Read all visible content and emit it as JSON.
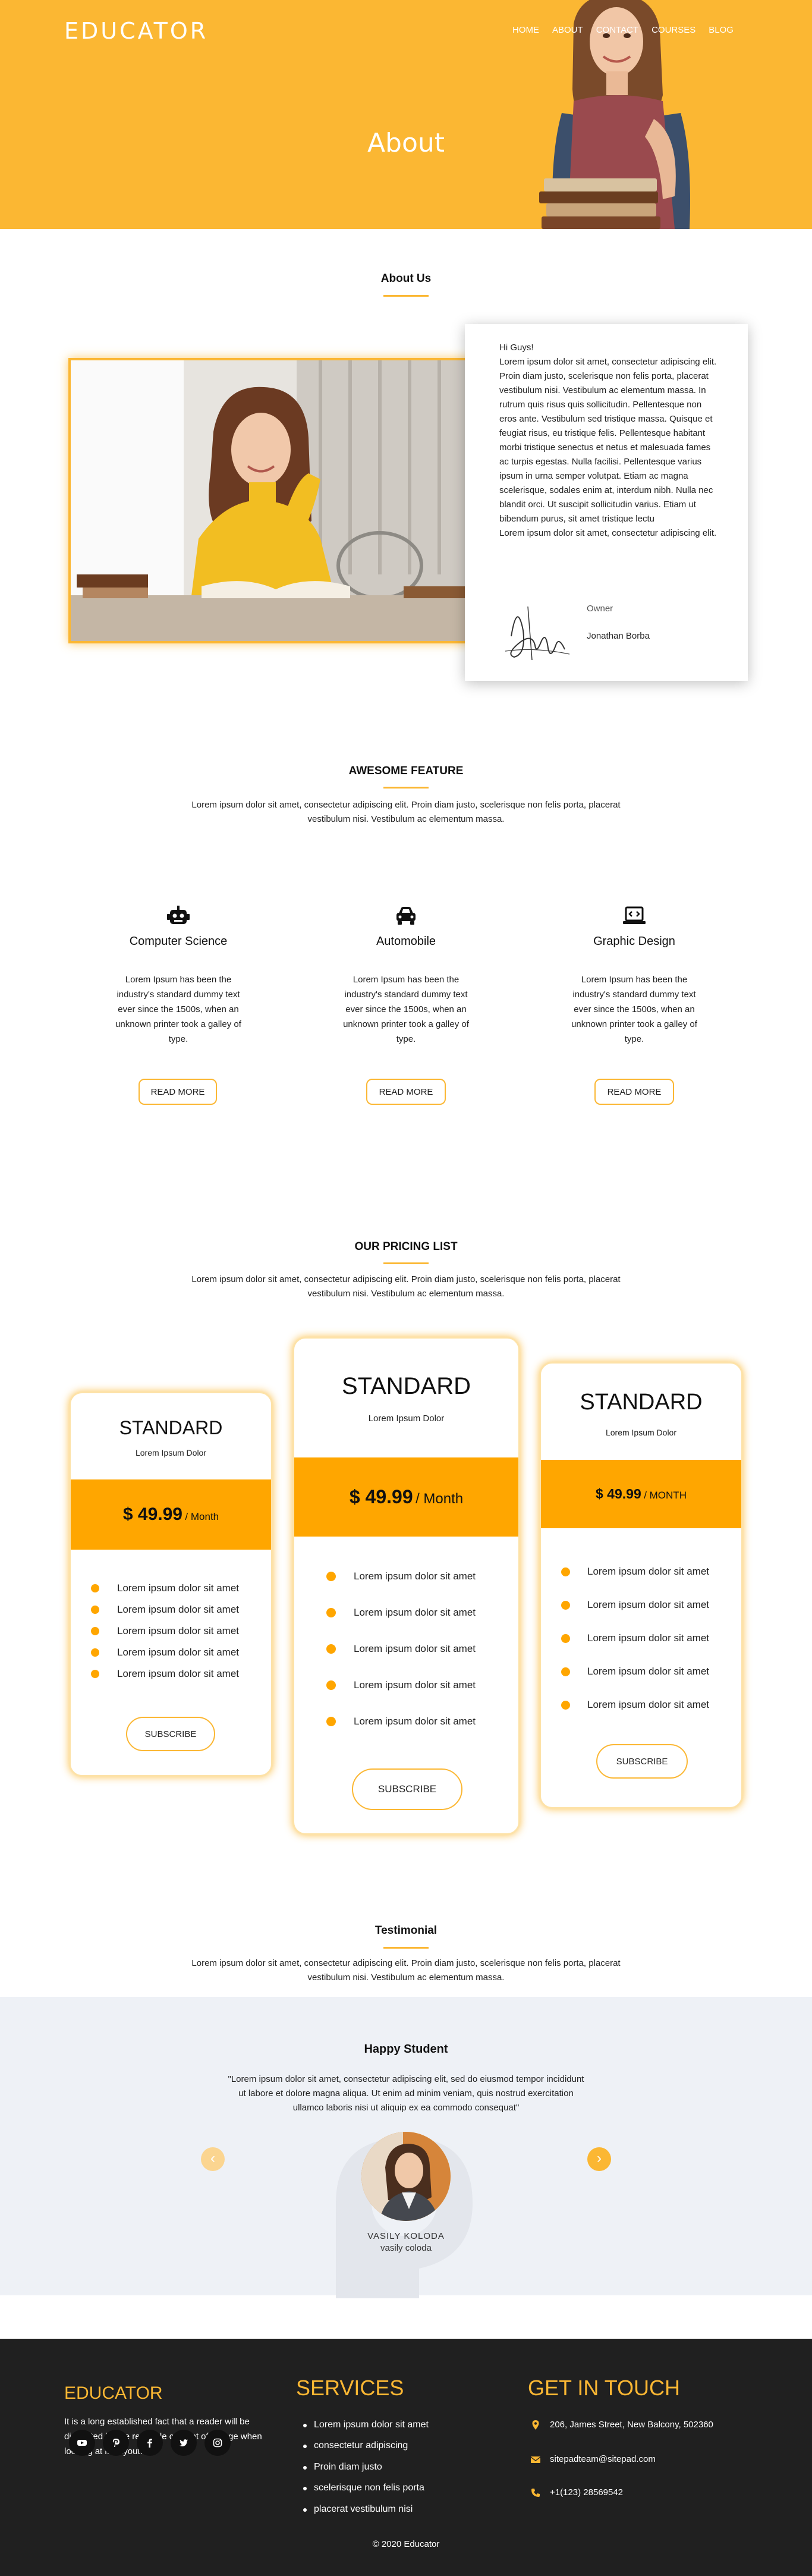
{
  "brand": "EDUCATOR",
  "nav": [
    "HOME",
    "ABOUT",
    "CONTACT",
    "COURSES",
    "BLOG"
  ],
  "hero": {
    "title": "About"
  },
  "about": {
    "heading": "About Us",
    "greeting": "Hi Guys!",
    "body": "Lorem ipsum dolor sit amet, consectetur adipiscing elit. Proin diam justo, scelerisque non felis porta, placerat vestibulum nisi. Vestibulum ac elementum massa. In rutrum quis risus quis sollicitudin. Pellentesque non eros ante. Vestibulum sed tristique massa. Quisque et feugiat risus, eu tristique felis. Pellentesque habitant morbi tristique senectus et netus et malesuada fames ac turpis egestas. Nulla facilisi. Pellentesque varius ipsum in urna semper volutpat. Etiam ac magna scelerisque, sodales enim at, interdum nibh. Nulla nec blandit orci. Ut suscipit sollicitudin varius. Etiam ut bibendum purus, sit amet tristique lectu",
    "body2": "Lorem ipsum dolor sit amet, consectetur adipiscing elit.",
    "owner_role": "Owner",
    "owner_name": "Jonathan Borba"
  },
  "features": {
    "heading": "AWESOME FEATURE",
    "intro": "Lorem ipsum dolor sit amet, consectetur adipiscing elit. Proin diam justo, scelerisque non felis porta, placerat vestibulum nisi. Vestibulum ac elementum massa.",
    "items": [
      {
        "icon": "robot-icon",
        "title": "Computer Science",
        "text": "Lorem Ipsum has been the industry's standard dummy text ever since the 1500s, when an unknown printer took a galley of type.",
        "button": "READ MORE"
      },
      {
        "icon": "car-icon",
        "title": "Automobile",
        "text": "Lorem Ipsum has been the industry's standard dummy text ever since the 1500s, when an unknown printer took a galley of type.",
        "button": "READ MORE"
      },
      {
        "icon": "laptop-code-icon",
        "title": "Graphic Design",
        "text": "Lorem Ipsum has been the industry's standard dummy text ever since the 1500s, when an unknown printer took a galley of type.",
        "button": "READ MORE"
      }
    ]
  },
  "pricing": {
    "heading": "OUR PRICING LIST",
    "intro": "Lorem ipsum dolor sit amet, consectetur adipiscing elit. Proin diam justo, scelerisque non felis porta, placerat vestibulum nisi. Vestibulum ac elementum massa.",
    "plans": [
      {
        "name": "STANDARD",
        "subtitle": "Lorem Ipsum Dolor",
        "price": "$ 49.99",
        "period": "/ Month",
        "features": [
          "Lorem ipsum dolor sit amet",
          "Lorem ipsum dolor sit amet",
          "Lorem ipsum dolor sit amet",
          "Lorem ipsum dolor sit amet",
          "Lorem ipsum dolor sit amet"
        ],
        "button": "SUBSCRIBE"
      },
      {
        "name": "STANDARD",
        "subtitle": "Lorem Ipsum Dolor",
        "price": "$ 49.99",
        "period": "/ Month",
        "features": [
          "Lorem ipsum dolor sit amet",
          "Lorem ipsum dolor sit amet",
          "Lorem ipsum dolor sit amet",
          "Lorem ipsum dolor sit amet",
          "Lorem ipsum dolor sit amet"
        ],
        "button": "SUBSCRIBE"
      },
      {
        "name": "STANDARD",
        "subtitle": "Lorem Ipsum Dolor",
        "price": "$ 49.99",
        "period": "/ MONTH",
        "features": [
          "Lorem ipsum dolor sit amet",
          "Lorem ipsum dolor sit amet",
          "Lorem ipsum dolor sit amet",
          "Lorem ipsum dolor sit amet",
          "Lorem ipsum dolor sit amet"
        ],
        "button": "SUBSCRIBE"
      }
    ]
  },
  "testimonial": {
    "heading": "Testimonial",
    "intro": "Lorem ipsum dolor sit amet, consectetur adipiscing elit. Proin diam justo, scelerisque non felis porta, placerat vestibulum nisi. Vestibulum ac elementum massa.",
    "subheading": "Happy Student",
    "quote_line1": "\"Lorem ipsum dolor sit amet, consectetur adipiscing elit, sed do eiusmod tempor incididunt",
    "quote_line2": "ut labore et dolore magna aliqua. Ut enim ad minim veniam, quis nostrud exercitation",
    "quote_line3": "ullamco laboris nisi ut aliquip ex ea commodo consequat\"",
    "name": "VASILY KOLODA",
    "handle": "vasily coloda",
    "prev": "‹",
    "next": "›"
  },
  "footer": {
    "brand": "EDUCATOR",
    "about_line1": "It is a long established fact that a reader will be",
    "about_line2": "distracted by the readable content of a page when",
    "about_line3": "looking at its layout.",
    "social": [
      "youtube-icon",
      "pinterest-icon",
      "facebook-icon",
      "twitter-icon",
      "instagram-icon"
    ],
    "services_heading": "SERVICES",
    "services": [
      "Lorem ipsum dolor sit amet",
      "consectetur adipiscing",
      "Proin diam justo",
      "scelerisque non felis porta",
      "placerat vestibulum nisi"
    ],
    "contact_heading": "GET IN TOUCH",
    "address": "206, James Street, New Balcony, 502360",
    "email": "sitepadteam@sitepad.com",
    "phone": "+1(123) 28569542",
    "copyright": "© 2020 Educator"
  }
}
